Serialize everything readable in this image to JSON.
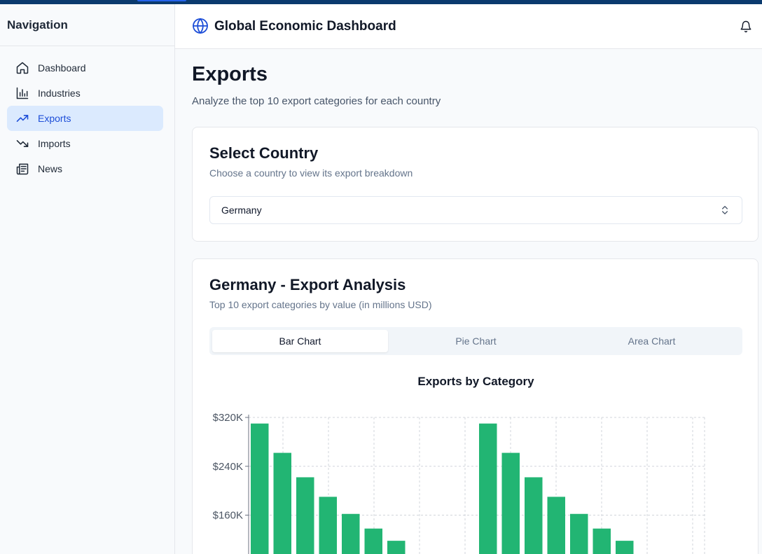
{
  "sidebar": {
    "title": "Navigation",
    "items": [
      {
        "label": "Dashboard",
        "icon": "home-icon",
        "active": false
      },
      {
        "label": "Industries",
        "icon": "bar-chart-icon",
        "active": false
      },
      {
        "label": "Exports",
        "icon": "trending-up-icon",
        "active": true
      },
      {
        "label": "Imports",
        "icon": "trending-down-icon",
        "active": false
      },
      {
        "label": "News",
        "icon": "newspaper-icon",
        "active": false
      }
    ]
  },
  "header": {
    "title": "Global Economic Dashboard",
    "logo_icon": "globe-icon",
    "notification_icon": "bell-icon"
  },
  "page": {
    "title": "Exports",
    "subtitle": "Analyze the top 10 export categories for each country"
  },
  "country_card": {
    "title": "Select Country",
    "description": "Choose a country to view its export breakdown",
    "selected": "Germany",
    "select_icon": "chevrons-up-down-icon"
  },
  "analysis_card": {
    "title": "Germany - Export Analysis",
    "description": "Top 10 export categories by value (in millions USD)",
    "tabs": [
      {
        "label": "Bar Chart",
        "active": true
      },
      {
        "label": "Pie Chart",
        "active": false
      },
      {
        "label": "Area Chart",
        "active": false
      }
    ]
  },
  "colors": {
    "accent": "#1d4ed8",
    "active_bg": "#dbeafe",
    "bar": "#22b573",
    "topbar": "#0b3a6e"
  },
  "chart_data": {
    "type": "bar",
    "title": "Exports by Category",
    "yticks": [
      "$320K",
      "$240K",
      "$160K"
    ],
    "ylim": [
      0,
      320000
    ],
    "grid": true,
    "series": [
      {
        "values": [
          310000,
          262000,
          222000,
          190000,
          162000,
          138000,
          118000
        ]
      },
      {
        "values": [
          310000,
          262000,
          222000,
          190000,
          162000,
          138000,
          118000
        ]
      }
    ]
  }
}
